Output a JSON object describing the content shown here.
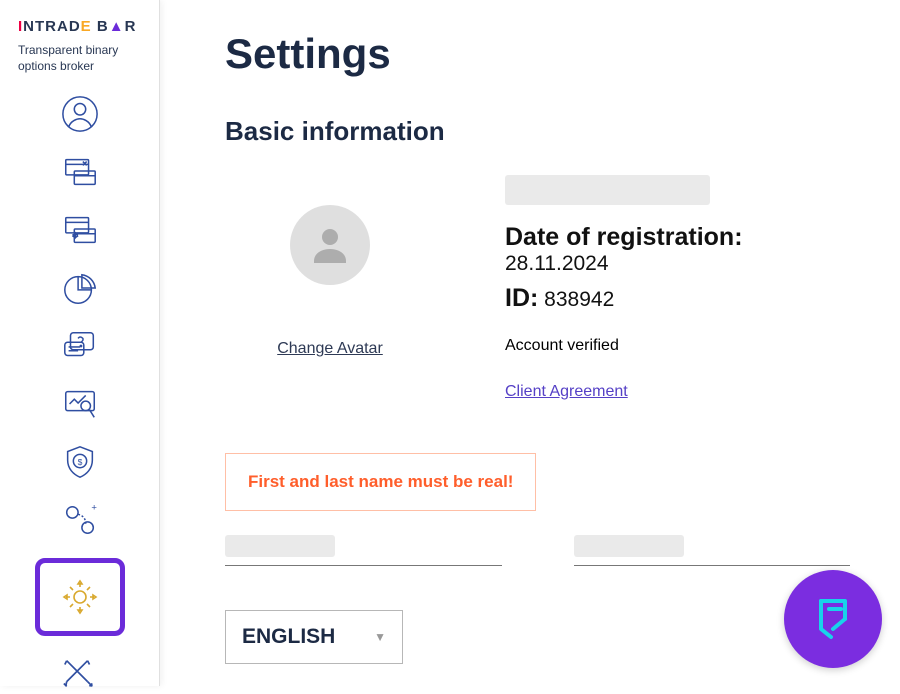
{
  "brand": {
    "name": "INTRADE BAR",
    "tagline": "Transparent binary options broker"
  },
  "page": {
    "title": "Settings",
    "section": "Basic information"
  },
  "avatar": {
    "change_label": "Change Avatar"
  },
  "user": {
    "reg_label": "Date of registration:",
    "reg_date": "28.11.2024",
    "id_label": "ID:",
    "id_value": "838942",
    "verified": "Account verified",
    "agreement": "Client Agreement"
  },
  "warning": "First and last name must be real!",
  "language": {
    "selected": "ENGLISH"
  },
  "sidebar_icons": [
    "profile",
    "cashbox-deposit",
    "cashbox-withdraw",
    "stats",
    "faq",
    "analysis",
    "safety",
    "referral",
    "settings",
    "tournament"
  ]
}
